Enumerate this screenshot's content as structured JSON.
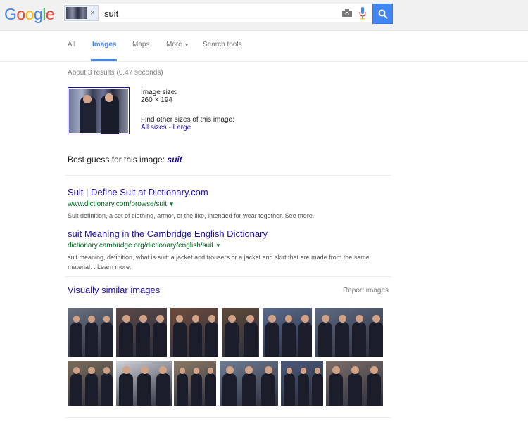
{
  "logo": "Google",
  "search": {
    "query": "suit"
  },
  "tabs": [
    {
      "label": "All",
      "active": false
    },
    {
      "label": "Images",
      "active": true
    },
    {
      "label": "Maps",
      "active": false
    },
    {
      "label": "More",
      "active": false
    },
    {
      "label": "Search tools",
      "active": false
    }
  ],
  "stats": "About 3 results (0.47 seconds)",
  "image_info": {
    "size_label": "Image size:",
    "size_value": "260 × 194",
    "find_label": "Find other sizes of this image:",
    "links": "All sizes - Large"
  },
  "best_guess": {
    "prefix": "Best guess for this image:",
    "term": "suit"
  },
  "results": [
    {
      "title": "Suit | Define Suit at Dictionary.com",
      "url": "www.dictionary.com/browse/suit",
      "snippet": "Suit definition, a set of clothing, armor, or the like, intended for wear together. See more."
    },
    {
      "title": "suit Meaning in the Cambridge English Dictionary",
      "url": "dictionary.cambridge.org/dictionary/english/suit",
      "snippet": "suit meaning, definition, what is suit: a jacket and trousers or a jacket and skirt that are made from the same material: . Learn more."
    }
  ],
  "similar": {
    "title": "Visually similar images",
    "report": "Report images"
  },
  "colors": {
    "link": "#1a0dab",
    "url": "#006621",
    "accent": "#4285f4"
  }
}
